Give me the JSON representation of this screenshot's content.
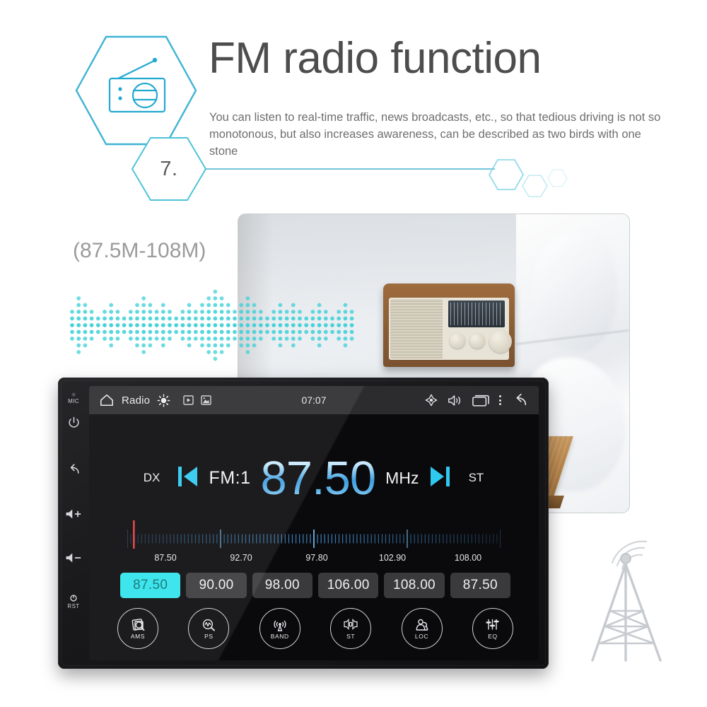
{
  "header": {
    "step_number": "7.",
    "badge_icon": "radio-icon",
    "title": "FM radio function",
    "description": "You can listen to real-time traffic, news broadcasts, etc., so that tedious driving is not so monotonous, but also increases awareness, can be described as two birds with one stone"
  },
  "frequency_range_label": "(87.5M-108M)",
  "photo": {
    "alt": "vintage wooden radio on a wooden nightstand beside a white bed"
  },
  "device": {
    "side_buttons": [
      {
        "name": "microphone",
        "icon": "mic-dot-icon",
        "label": "MIC"
      },
      {
        "name": "power",
        "icon": "power-icon",
        "label": ""
      },
      {
        "name": "back",
        "icon": "back-arrow-icon",
        "label": ""
      },
      {
        "name": "volume-up",
        "icon": "volume-up-icon",
        "label": ""
      },
      {
        "name": "volume-down",
        "icon": "volume-down-icon",
        "label": ""
      },
      {
        "name": "reset",
        "icon": "reset-pinhole-icon",
        "label": "RST"
      }
    ],
    "statusbar": {
      "home_icon": "home-icon",
      "app_label": "Radio",
      "brightness_icon": "brightness-sun-icon",
      "video_icon": "video-play-icon",
      "gallery_icon": "image-icon",
      "time": "07:07",
      "gps_icon": "gps-location-icon",
      "volume_icon": "volume-icon",
      "recents_icon": "recent-apps-icon",
      "menu_icon": "overflow-menu-icon",
      "back_icon": "back-arrow-icon"
    },
    "radio": {
      "dx_label": "DX",
      "prev_icon": "seek-previous-icon",
      "band_label": "FM:1",
      "frequency": "87.50",
      "unit": "MHz",
      "next_icon": "seek-next-icon",
      "st_label": "ST",
      "tuner_indicator_value": "87.50",
      "scale_ticks": [
        "87.50",
        "92.70",
        "97.80",
        "102.90",
        "108.00"
      ],
      "scale_min": 87.5,
      "scale_max": 108.0,
      "presets": [
        {
          "value": "87.50",
          "active": true
        },
        {
          "value": "90.00",
          "active": false
        },
        {
          "value": "98.00",
          "active": false
        },
        {
          "value": "106.00",
          "active": false
        },
        {
          "value": "108.00",
          "active": false
        },
        {
          "value": "87.50",
          "active": false
        }
      ],
      "functions": [
        {
          "label": "AMS",
          "icon": "auto-memory-scan-icon"
        },
        {
          "label": "PS",
          "icon": "program-scan-icon"
        },
        {
          "label": "BAND",
          "icon": "band-antenna-icon"
        },
        {
          "label": "ST",
          "icon": "stereo-speaker-icon"
        },
        {
          "label": "LOC",
          "icon": "local-distance-icon"
        },
        {
          "label": "EQ",
          "icon": "equalizer-icon"
        }
      ]
    }
  },
  "decor": {
    "tower_icon": "radio-tower-icon",
    "waveform_icon": "sound-wave-dots-icon",
    "hexagons_icon": "hexagon-cluster-icon"
  },
  "colors": {
    "accent_cyan": "#2fe3ea",
    "brand_teal": "#4fc3d9",
    "title_gray": "#4d4d4d",
    "body_gray": "#6e6e6e",
    "freq_blue": "#3f9fe0",
    "indicator_red": "#e03a3a",
    "screen_black": "#0a0a0c"
  }
}
